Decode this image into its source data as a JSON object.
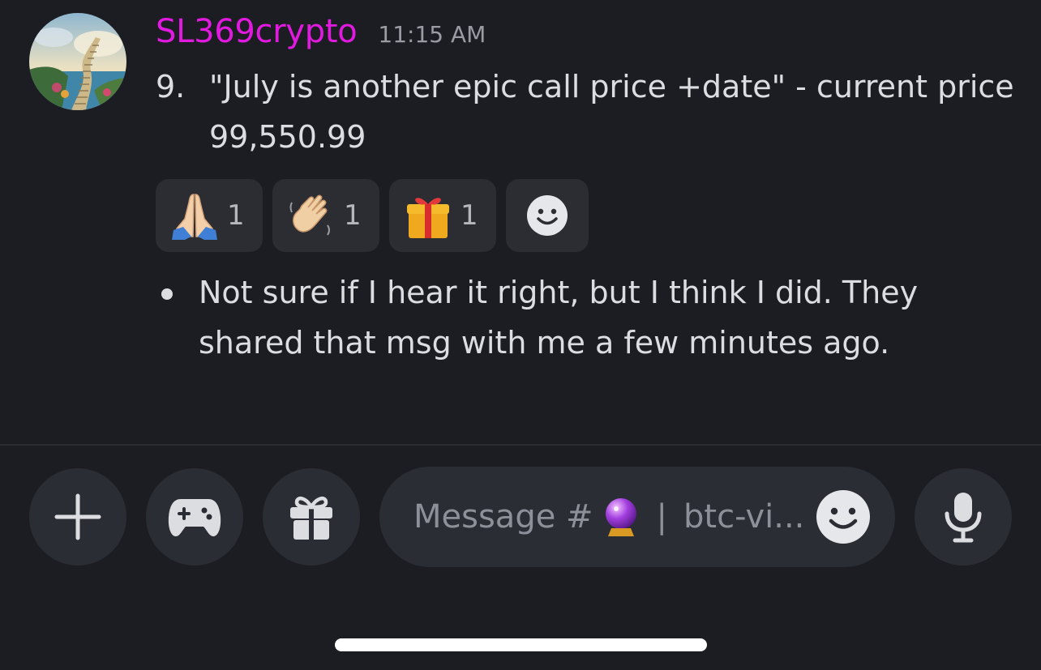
{
  "message": {
    "username": "SL369crypto",
    "timestamp": "11:15 AM",
    "avatar_icon": "stairway-to-heaven-avatar",
    "list_item": {
      "marker": "9.",
      "text": "\"July is another epic call price +date\" - current price 99,550.99"
    },
    "reactions": [
      {
        "emoji": "folded-hands",
        "count": "1"
      },
      {
        "emoji": "waving-hand",
        "count": "1"
      },
      {
        "emoji": "gift",
        "count": "1"
      }
    ],
    "add_reaction_icon": "smiley-icon",
    "bullet_text": "Not sure if I hear it right, but I think I did.  They shared that msg with me a few minutes ago."
  },
  "composer": {
    "placeholder_prefix": "Message #",
    "placeholder_emoji": "crystal-ball",
    "placeholder_separator": "|",
    "placeholder_channel": "btc-vi...",
    "buttons": {
      "plus": "plus-icon",
      "games": "gamepad-icon",
      "gift": "gift-icon",
      "emoji": "smiley-icon",
      "voice": "microphone-icon"
    }
  },
  "colors": {
    "background": "#1c1d23",
    "username": "#e21ae0",
    "surface": "#2b2d34",
    "text": "#dcdde1",
    "muted": "#9a9ba3"
  }
}
